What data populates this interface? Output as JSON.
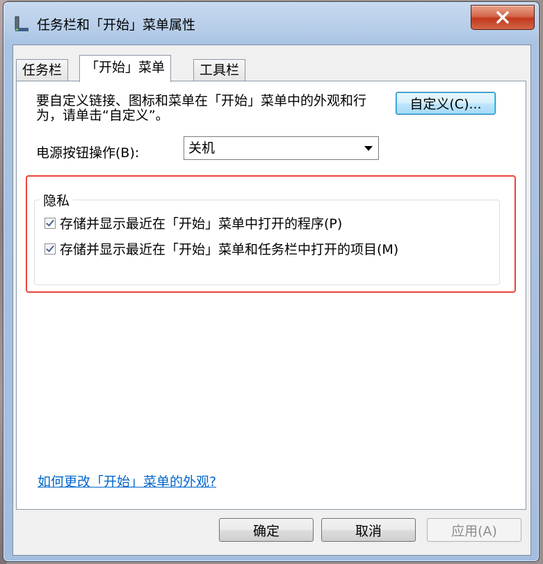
{
  "window": {
    "title": "任务栏和「开始」菜单属性",
    "close_symbol": "X"
  },
  "tabs": [
    {
      "label": "任务栏"
    },
    {
      "label": "「开始」菜单"
    },
    {
      "label": "工具栏"
    }
  ],
  "start_menu": {
    "description": "要自定义链接、图标和菜单在「开始」菜单中的外观和行为，请单击“自定义”。",
    "customize_button": "自定义(C)...",
    "power_label": "电源按钮操作(B):",
    "power_value": "关机",
    "privacy": {
      "title": "隐私",
      "options": [
        {
          "label": "存储并显示最近在「开始」菜单中打开的程序(P)",
          "checked": true
        },
        {
          "label": "存储并显示最近在「开始」菜单和任务栏中打开的项目(M)",
          "checked": true
        }
      ]
    },
    "help_link": "如何更改「开始」菜单的外观?"
  },
  "footer": {
    "ok": "确定",
    "cancel": "取消",
    "apply": "应用(A)"
  },
  "colors": {
    "highlight_border": "#e8443a",
    "link": "#0066cc",
    "close_button": "#c2391d"
  }
}
